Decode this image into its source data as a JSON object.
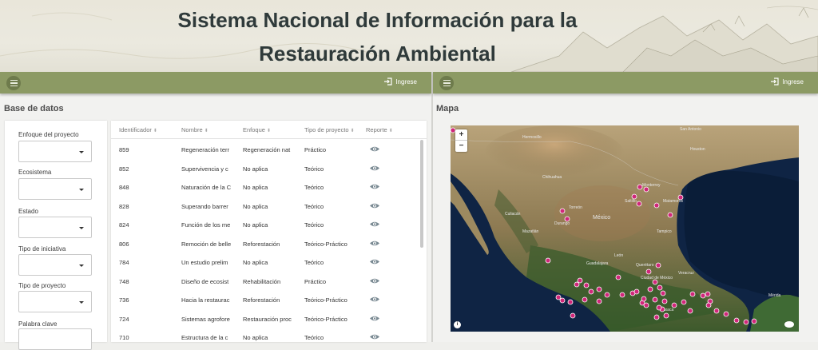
{
  "header": {
    "title_line1": "Sistema Nacional de Información para la",
    "title_line2": "Restauración Ambiental"
  },
  "colors": {
    "toolbar": "#8c9a64",
    "accent_marker": "#d0277a",
    "title_text": "#2f3a3a"
  },
  "left_panel": {
    "login_label": "Ingrese",
    "menu_icon": "hamburger-icon",
    "section_title": "Base de datos",
    "filters": [
      {
        "label": "Enfoque del proyecto",
        "value": ""
      },
      {
        "label": "Ecosistema",
        "value": ""
      },
      {
        "label": "Estado",
        "value": ""
      },
      {
        "label": "Tipo de iniciativa",
        "value": ""
      },
      {
        "label": "Tipo de proyecto",
        "value": ""
      },
      {
        "label": "Palabra clave",
        "value": ""
      }
    ],
    "table": {
      "columns": [
        "Identificador",
        "Nombre",
        "Enfoque",
        "Tipo de proyecto",
        "Reporte"
      ],
      "rows": [
        {
          "id": "859",
          "nombre": "Regeneración terr",
          "enfoque": "Regeneración nat",
          "tipo": "Práctico"
        },
        {
          "id": "852",
          "nombre": "Supervivencia y c",
          "enfoque": "No aplica",
          "tipo": "Teórico"
        },
        {
          "id": "848",
          "nombre": "Naturación de la C",
          "enfoque": "No aplica",
          "tipo": "Teórico"
        },
        {
          "id": "828",
          "nombre": "Superando barrer",
          "enfoque": "No aplica",
          "tipo": "Teórico"
        },
        {
          "id": "824",
          "nombre": "Función de los me",
          "enfoque": "No aplica",
          "tipo": "Teórico"
        },
        {
          "id": "806",
          "nombre": "Remoción de belle",
          "enfoque": "Reforestación",
          "tipo": "Teórico-Práctico"
        },
        {
          "id": "784",
          "nombre": "Un estudio prelim",
          "enfoque": "No aplica",
          "tipo": "Teórico"
        },
        {
          "id": "748",
          "nombre": "Diseño de ecosist",
          "enfoque": "Rehabilitación",
          "tipo": "Práctico"
        },
        {
          "id": "736",
          "nombre": "Hacia la restaurac",
          "enfoque": "Reforestación",
          "tipo": "Teórico-Práctico"
        },
        {
          "id": "724",
          "nombre": "Sistemas agrofore",
          "enfoque": "Restauración proc",
          "tipo": "Teórico-Práctico"
        },
        {
          "id": "710",
          "nombre": "Estructura de la c",
          "enfoque": "No aplica",
          "tipo": "Teórico"
        }
      ]
    }
  },
  "right_panel": {
    "login_label": "Ingrese",
    "section_title": "Mapa",
    "zoom_in": "+",
    "zoom_out": "−",
    "map_labels": {
      "mexico": "México",
      "san_antonio": "San Antonio",
      "houston": "Houston",
      "monterrey": "Monterrey",
      "chihuahua": "Chihuahua",
      "torreon": "Torreón",
      "mazatlan": "Mazatlán",
      "guadalajara": "Guadalajara",
      "leon": "León",
      "queretaro": "Querétaro",
      "ciudad_de_mexico": "Ciudad de México",
      "merida": "Mérida",
      "veracruz": "Veracruz",
      "oaxaca": "Oaxaca",
      "matamoros": "Matamoros",
      "saltillo": "Saltillo",
      "culiacan": "Culiacán",
      "durango": "Durango",
      "hermosillo": "Hermosillo",
      "tampico": "Tampico"
    }
  }
}
